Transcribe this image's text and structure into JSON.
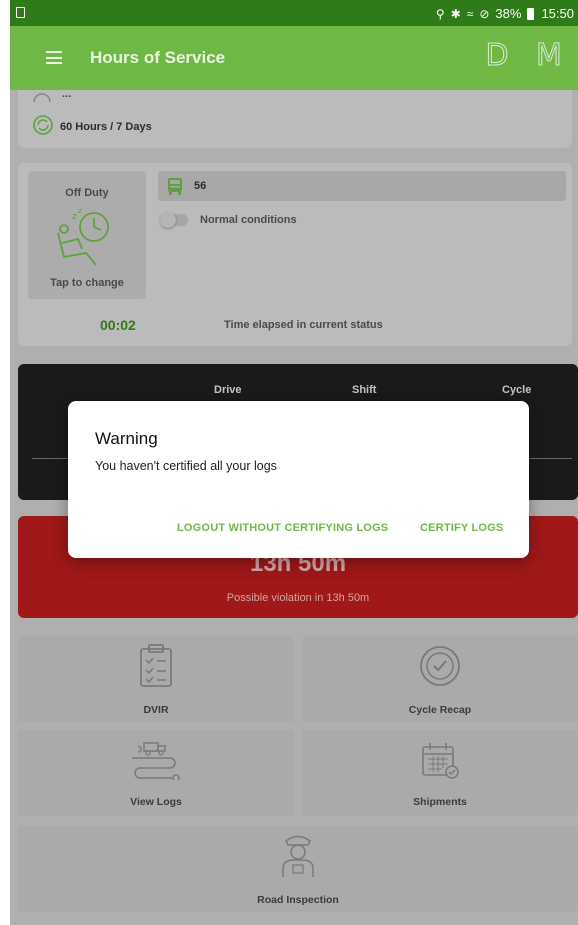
{
  "status_bar": {
    "battery": "38%",
    "time": "15:50",
    "icons": [
      "location-icon",
      "bluetooth-icon",
      "wifi-icon",
      "do-not-disturb-icon",
      "battery-icon"
    ]
  },
  "app_bar": {
    "title": "Hours of Service",
    "right_letters": [
      "D",
      "M"
    ]
  },
  "rule_card": {
    "partial_text": "...",
    "rule": "60 Hours / 7 Days"
  },
  "status_card": {
    "status_label": "Off Duty",
    "tap_label": "Tap to change",
    "truck_number": "56",
    "conditions_label": "Normal conditions",
    "elapsed_time": "00:02",
    "elapsed_label": "Time elapsed in current status"
  },
  "clocks_card": {
    "headers": [
      "Drive",
      "Shift",
      "Cycle"
    ]
  },
  "violation_card": {
    "time": "13h 50m",
    "subtitle": "Possible violation in 13h 50m"
  },
  "tiles": [
    {
      "label": "DVIR",
      "icon": "clipboard-icon"
    },
    {
      "label": "Cycle Recap",
      "icon": "clock-check-icon"
    },
    {
      "label": "View Logs",
      "icon": "route-truck-icon"
    },
    {
      "label": "Shipments",
      "icon": "calendar-check-icon"
    },
    {
      "label": "Road Inspection",
      "icon": "officer-icon"
    }
  ],
  "dialog": {
    "title": "Warning",
    "message": "You haven't certified all your logs",
    "logout_button": "LOGOUT WITHOUT CERTIFYING LOGS",
    "certify_button": "CERTIFY LOGS"
  },
  "colors": {
    "app_bar": "#6fb845",
    "status_bar": "#2f7a19",
    "accent": "#6fb845",
    "violation": "#b71c1c",
    "dark_card": "#1e1e1e"
  }
}
